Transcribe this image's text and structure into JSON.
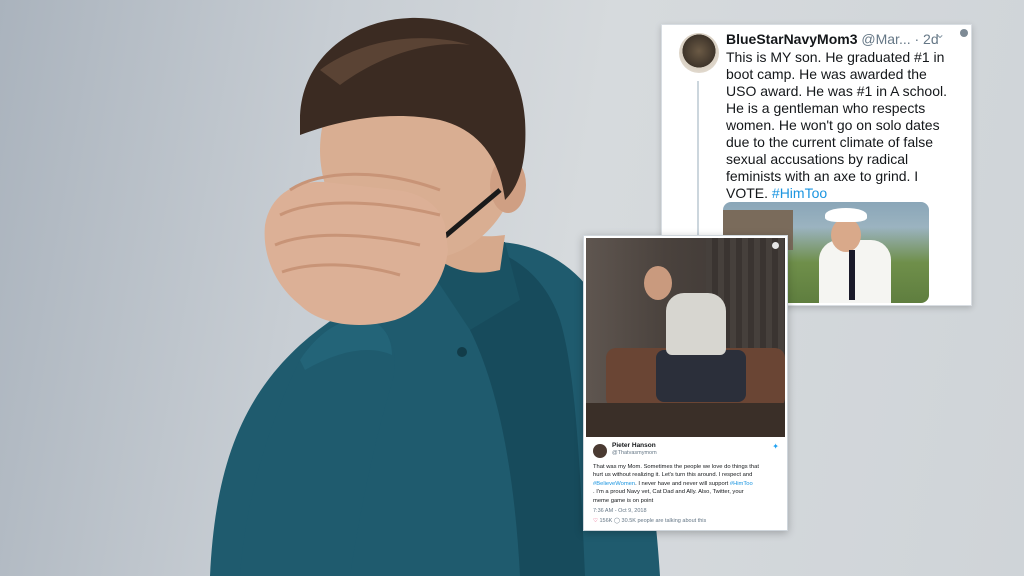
{
  "card1": {
    "name": "BlueStarNavyMom3",
    "handle": "@Mar...",
    "time": "· 2d",
    "body_lines": [
      "This is MY son. He graduated #1 in",
      "boot camp. He was awarded the",
      "USO award. He was #1 in A school.",
      "He is a gentleman who respects",
      "women. He won't go on solo dates",
      "due to the current climate of false",
      "sexual accusations by radical",
      "feminists with an axe to grind. I"
    ],
    "body_last_prefix": "VOTE. ",
    "hashtag": "#HimToo"
  },
  "card2": {
    "name": "Pieter Hanson",
    "handle": "@Thatvasmymom",
    "line1": "That was my Mom. Sometimes the people we love do things that",
    "line2": "hurt us without realizing it. Let's turn this around. I respect and",
    "hashtag1": "#BelieveWomen",
    "line3": ". I never have and never will support",
    "hashtag2": "#HimToo",
    "line4": ". I'm a proud Navy vet, Cat Dad and Ally. Also, Twitter, your",
    "line5": "meme game is on point",
    "time": "7:36 AM - Oct 9, 2018",
    "likes": "156K",
    "talking": "30.5K people are talking about this"
  },
  "colors": {
    "background": "#c9cfd5",
    "shirt": "#1f5b6e",
    "link": "#1b95e0"
  }
}
